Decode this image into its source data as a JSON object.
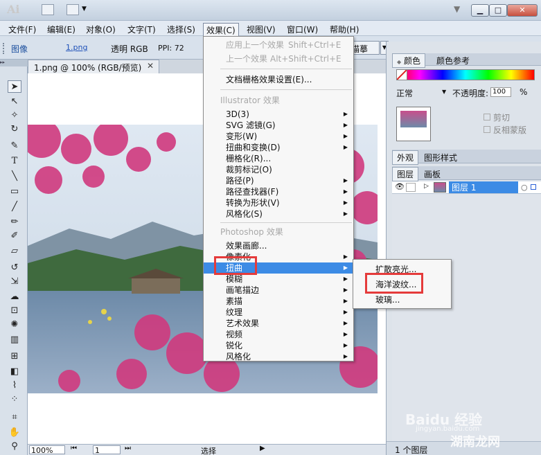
{
  "app": {
    "logo": "Ai",
    "winbtns": [
      "▁",
      "□",
      "✕"
    ],
    "menus": [
      "文件(F)",
      "编辑(E)",
      "对象(O)",
      "文字(T)",
      "选择(S)",
      "效果(C)",
      "视图(V)",
      "窗口(W)",
      "帮助(H)"
    ]
  },
  "control": {
    "type": "图像",
    "file": "1.png",
    "mode": "透明 RGB",
    "ppi": "PPI: 72",
    "trace": "描摹"
  },
  "document": {
    "tab": "1.png @ 100% (RGB/预览)",
    "close": "✕",
    "zoom": "100%",
    "page": "1",
    "status": "选择"
  },
  "effect_menu": {
    "top": [
      {
        "label": "应用上一个效果",
        "shortcut": "Shift+Ctrl+E",
        "disabled": true
      },
      {
        "label": "上一个效果",
        "shortcut": "Alt+Shift+Ctrl+E",
        "disabled": true
      }
    ],
    "doc_settings": "文档栅格效果设置(E)...",
    "illustrator_header": "Illustrator 效果",
    "illustrator_items": [
      "3D(3)",
      "SVG 滤镜(G)",
      "变形(W)",
      "扭曲和变换(D)",
      "栅格化(R)...",
      "裁剪标记(O)",
      "路径(P)",
      "路径查找器(F)",
      "转换为形状(V)",
      "风格化(S)"
    ],
    "photoshop_header": "Photoshop 效果",
    "photoshop_items": [
      "效果画廊...",
      "像素化",
      "扭曲",
      "模糊",
      "画笔描边",
      "素描",
      "纹理",
      "艺术效果",
      "视频",
      "锐化",
      "风格化"
    ]
  },
  "submenu": {
    "items": [
      "扩散亮光...",
      "海洋波纹...",
      "玻璃..."
    ]
  },
  "panels": {
    "color_tabs": [
      "颜色",
      "颜色参考"
    ],
    "blend_mode": "正常",
    "opacity_label": "不透明度:",
    "opacity_value": "100",
    "opacity_unit": "%",
    "checks": [
      "剪切",
      "反相蒙版"
    ],
    "appearance_tabs": [
      "外观",
      "图形样式"
    ],
    "layer_tabs": [
      "图层",
      "画板"
    ],
    "layer_name": "图层 1",
    "layer_count": "1 个图层"
  },
  "watermarks": [
    "Baidu 经验",
    "jingyan.baidu.com",
    "湖南龙网"
  ],
  "colors": {
    "highlight": "#3c8be5",
    "red_box": "#e53b3b"
  }
}
